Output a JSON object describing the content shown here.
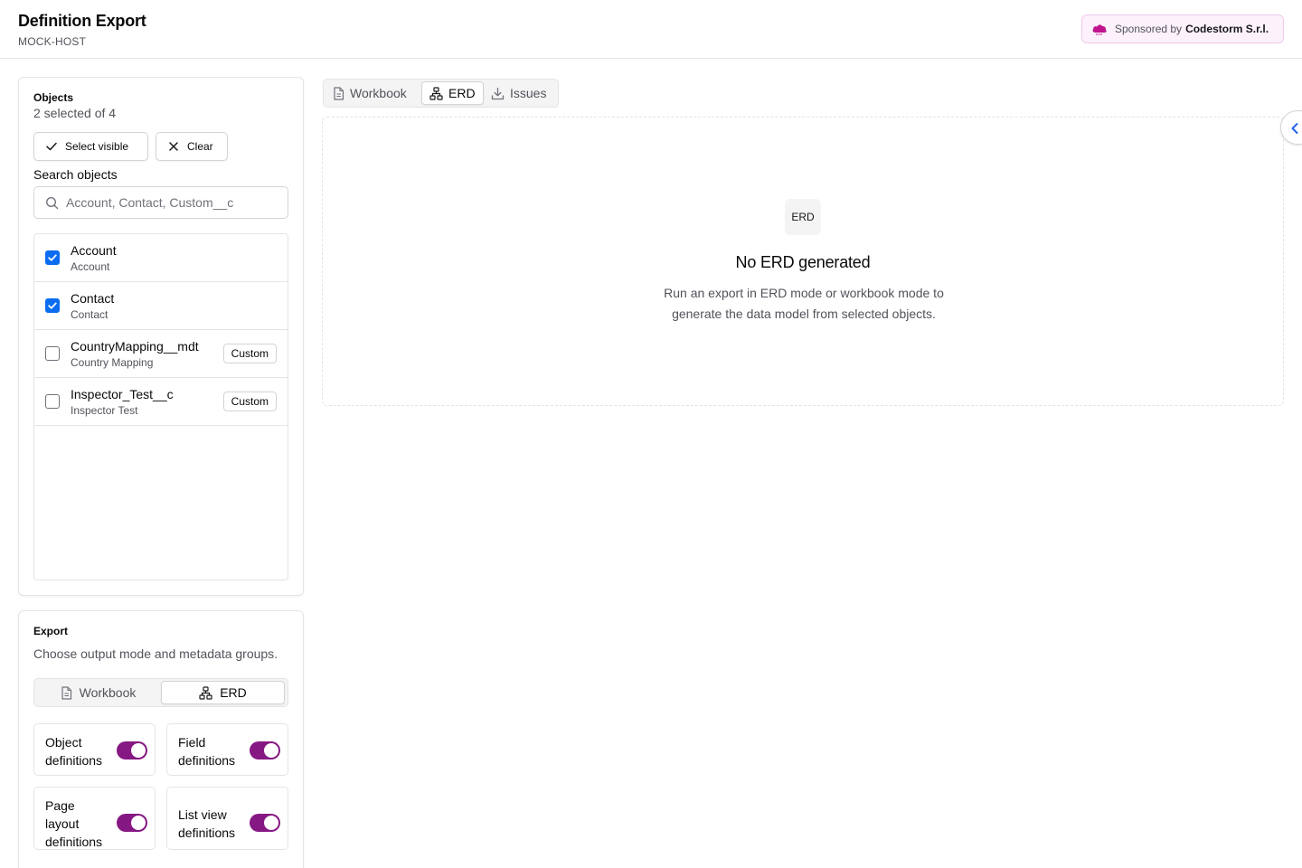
{
  "header": {
    "title": "Definition Export",
    "host": "MOCK-HOST",
    "sponsor_prefix": "Sponsored by",
    "sponsor_name": "Codestorm S.r.l.",
    "sponsor_icon": "cloud-icon",
    "sponsor_color": "#c0148f"
  },
  "objects_panel": {
    "title": "Objects",
    "selection_summary": "2 selected of 4",
    "select_visible_label": "Select visible",
    "clear_label": "Clear",
    "search_label": "Search objects",
    "search_placeholder": "Account, Contact, Custom__c",
    "search_value": "",
    "items": [
      {
        "api_name": "Account",
        "label": "Account",
        "checked": true,
        "badge": ""
      },
      {
        "api_name": "Contact",
        "label": "Contact",
        "checked": true,
        "badge": ""
      },
      {
        "api_name": "CountryMapping__mdt",
        "label": "Country Mapping",
        "checked": false,
        "badge": "Custom"
      },
      {
        "api_name": "Inspector_Test__c",
        "label": "Inspector Test",
        "checked": false,
        "badge": "Custom"
      }
    ]
  },
  "export_panel": {
    "title": "Export",
    "subtitle": "Choose output mode and metadata groups.",
    "modes": [
      {
        "label": "Workbook",
        "active": false
      },
      {
        "label": "ERD",
        "active": true
      }
    ],
    "groups": [
      {
        "label": "Object definitions",
        "enabled": true
      },
      {
        "label": "Field definitions",
        "enabled": true
      },
      {
        "label": "Page layout definitions",
        "enabled": true
      },
      {
        "label": "List view definitions",
        "enabled": true
      }
    ]
  },
  "main": {
    "tabs": [
      {
        "label": "Workbook",
        "active": false,
        "icon": "file-icon"
      },
      {
        "label": "ERD",
        "active": true,
        "icon": "network-icon"
      },
      {
        "label": "Issues",
        "active": false,
        "icon": "download-icon"
      }
    ],
    "empty_state": {
      "chip": "ERD",
      "title": "No ERD generated",
      "description": "Run an export in ERD mode or workbook mode to generate the data model from selected objects."
    }
  },
  "colors": {
    "accent_purple": "#861883",
    "checkbox_blue": "#0a6cf0",
    "collapse_chevron": "#2563eb"
  }
}
